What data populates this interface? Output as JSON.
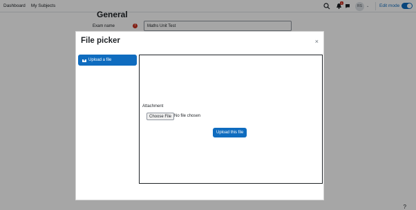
{
  "navbar": {
    "links": [
      "Dashboard",
      "My Subjects"
    ],
    "notification_count": "1",
    "user_initials": "RS",
    "edit_mode_label": "Edit mode",
    "edit_mode_on": true
  },
  "background_form": {
    "section_heading": "General",
    "exam_name_label": "Exam name",
    "exam_name_value": "Maths Unit Test",
    "help_text": "?"
  },
  "file_picker": {
    "title": "File picker",
    "close_glyph": "×",
    "sidebar_items": [
      {
        "label": "Upload a file",
        "icon": "upload-icon",
        "active": true
      }
    ],
    "attachment_label": "Attachment",
    "choose_file_label": "Choose File",
    "no_file_text": "No file chosen",
    "upload_button_label": "Upload this file"
  },
  "colors": {
    "primary": "#0f6cbf",
    "danger": "#ca3120",
    "overlay": "rgba(0,0,0,0.35)"
  }
}
